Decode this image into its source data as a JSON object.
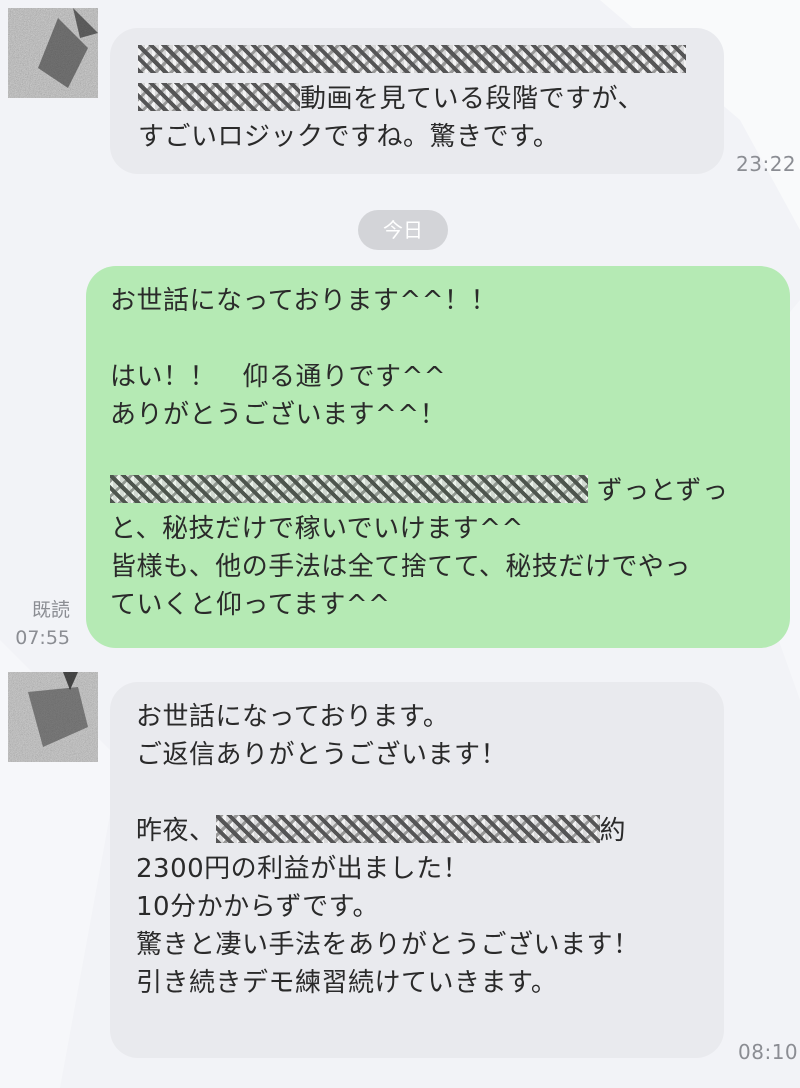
{
  "date_separator": "今日",
  "messages": [
    {
      "direction": "incoming",
      "lines": [
        {
          "blurred": true
        },
        {
          "blurred_prefix": true,
          "text": "動画を見ている段階ですが、"
        },
        {
          "text": "すごいロジックですね。驚きです。"
        }
      ],
      "time": "23:22"
    },
    {
      "direction": "outgoing",
      "lines": [
        {
          "text": "お世話になっております^^！！"
        },
        {
          "text": ""
        },
        {
          "text": "はい！！　仰る通りです^^"
        },
        {
          "text": "ありがとうございます^^！"
        },
        {
          "text": ""
        },
        {
          "blurred_prefix": true,
          "text": "ずっとずっ"
        },
        {
          "text": "と、秘技だけで稼いでいけます^^"
        },
        {
          "text": "皆様も、他の手法は全て捨てて、秘技だけでやっ"
        },
        {
          "text": "ていくと仰ってます^^"
        }
      ],
      "read_label": "既読",
      "time": "07:55"
    },
    {
      "direction": "incoming",
      "lines": [
        {
          "text": "お世話になっております。"
        },
        {
          "text": "ご返信ありがとうございます！"
        },
        {
          "text": ""
        },
        {
          "text_before": "昨夜、",
          "blurred_middle": true,
          "text": "約"
        },
        {
          "text": "2300円の利益が出ました！"
        },
        {
          "text": "10分かからずです。"
        },
        {
          "text": "驚きと凄い手法をありがとうございます！"
        },
        {
          "text": "引き続きデモ練習続けていきます。"
        }
      ],
      "time": "08:10"
    }
  ],
  "colors": {
    "background": "#f2f3f7",
    "incoming_bubble": "#e9eaee",
    "outgoing_bubble": "#b5eab4",
    "timestamp": "#8b8d93",
    "date_chip": "#d3d4d8"
  }
}
